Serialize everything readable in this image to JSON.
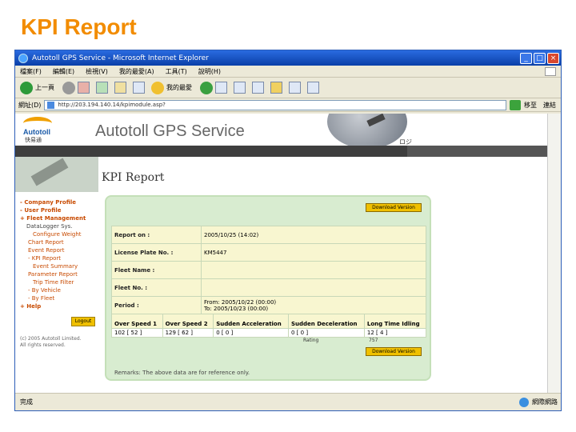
{
  "slide": {
    "title": "KPI Report"
  },
  "window": {
    "title": "Autotoll GPS Service - Microsoft Internet Explorer",
    "menu": [
      "檔案(F)",
      "編輯(E)",
      "檢視(V)",
      "我的最愛(A)",
      "工具(T)",
      "說明(H)"
    ],
    "toolbar": {
      "back": "上一頁",
      "favorites": "我的最愛"
    },
    "address": {
      "label": "網址(D)",
      "url": "http://203.194.140.14/kpimodule.asp?",
      "go": "移至",
      "links": "連結"
    },
    "status": {
      "left": "完成",
      "zone": "網際網路"
    }
  },
  "site": {
    "logo_name": "Autotoll",
    "logo_cn": "快易通",
    "name": "Autotoll GPS Service",
    "header_text": "ロジ",
    "page_heading": "KPI Report"
  },
  "nav": {
    "items": [
      {
        "label": "- Company Profile",
        "level": 0
      },
      {
        "label": "- User Profile",
        "level": 0
      },
      {
        "label": "+ Fleet Management",
        "level": 0
      },
      {
        "label": "DataLogger Sys.",
        "level": 1
      },
      {
        "label": "Configure Weight",
        "level": 2
      },
      {
        "label": "Chart Report",
        "level": 2
      },
      {
        "label": "Event Report",
        "level": 2
      },
      {
        "label": "- KPI Report",
        "level": 2
      },
      {
        "label": "Event Summary",
        "level": 3
      },
      {
        "label": "Parameter Report",
        "level": 2
      },
      {
        "label": "Trip Time Filter",
        "level": 2
      },
      {
        "label": "- By Vehicle",
        "level": 2
      },
      {
        "label": "- By Fleet",
        "level": 2
      },
      {
        "label": "+ Help",
        "level": 0
      }
    ],
    "logout": "Logout",
    "copyright_1": "(c) 2005 Autotoll Limited.",
    "copyright_2": "All rights reserved."
  },
  "report": {
    "download_top": "Download Version",
    "download_bottom": "Download Version",
    "fields": [
      {
        "label": "Report on :",
        "value": "2005/10/25 (14:02)"
      },
      {
        "label": "License Plate No. :",
        "value": "KM5447"
      },
      {
        "label": "Fleet Name :",
        "value": ""
      },
      {
        "label": "Fleet No. :",
        "value": ""
      },
      {
        "label": "Period :",
        "value_from": "From: 2005/10/22 (00:00)",
        "value_to": "To: 2005/10/23 (00:00)"
      }
    ],
    "stats_headers": [
      "Over Speed 1",
      "Over Speed 2",
      "Sudden Acceleration",
      "Sudden Deceleration",
      "Long Time Idling"
    ],
    "stats_values": [
      "102 [ 52 ]",
      "129 [ 62 ]",
      "0 [ 0 ]",
      "0 [ 0 ]",
      "12 [ 4 ]"
    ],
    "rating_label": "Rating",
    "rating_value": "757",
    "remarks": "Remarks: The above data are for reference only."
  }
}
